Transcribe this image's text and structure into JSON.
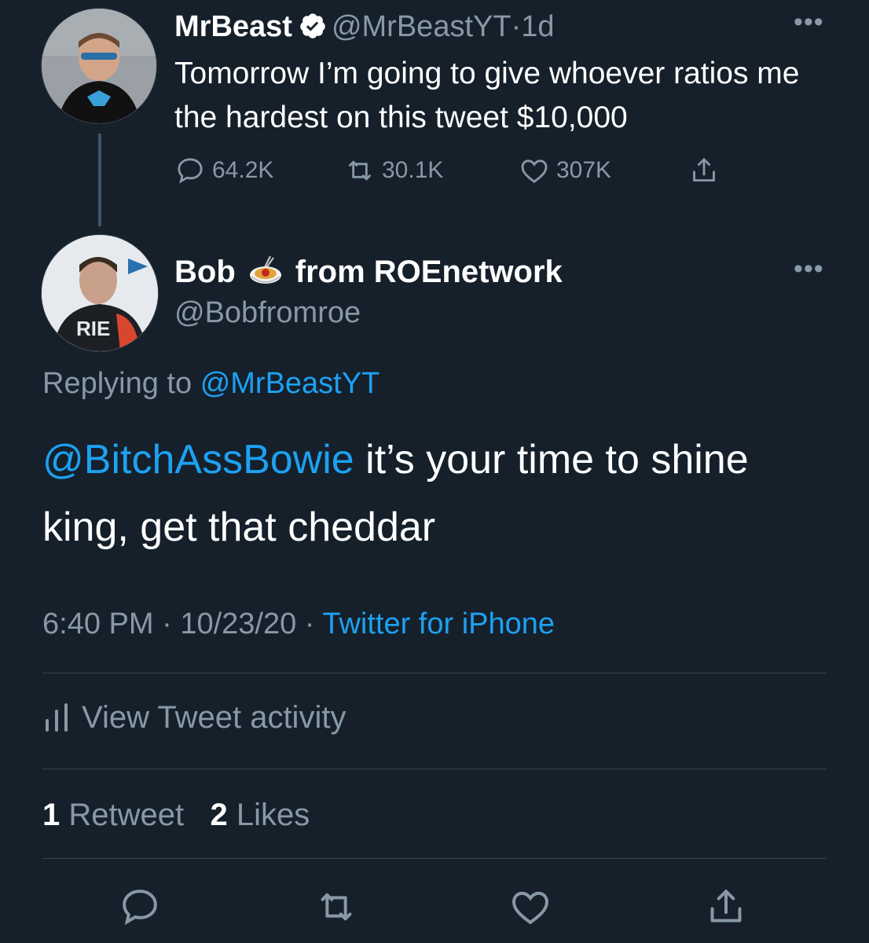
{
  "original_tweet": {
    "name": "MrBeast",
    "handle": "@MrBeastYT",
    "separator": "·",
    "time": "1d",
    "text": "Tomorrow I’m going to give whoever ratios me the hardest on this tweet $10,000",
    "stats": {
      "replies": "64.2K",
      "retweets": "30.1K",
      "likes": "307K"
    }
  },
  "reply_tweet": {
    "name_first": "Bob",
    "name_rest": "from ROEnetwork",
    "handle": "@Bobfromroe",
    "replying_label": "Replying to",
    "replying_handle": "@MrBeastYT",
    "mention": "@BitchAssBowie",
    "text": " it’s your time to shine king, get that cheddar",
    "time": "6:40 PM",
    "date": "10/23/20",
    "separator": "·",
    "source": "Twitter for iPhone",
    "activity_label": "View Tweet activity",
    "retweet_count": "1",
    "retweet_label": "Retweet",
    "like_count": "2",
    "like_label": "Likes"
  },
  "colors": {
    "background": "#15202b",
    "accent": "#1da1f2",
    "muted": "#8899a6"
  },
  "icons": [
    "verified-badge-icon",
    "more-icon",
    "reply-icon",
    "retweet-icon",
    "like-icon",
    "share-icon",
    "activity-icon",
    "spaghetti-emoji-icon"
  ]
}
